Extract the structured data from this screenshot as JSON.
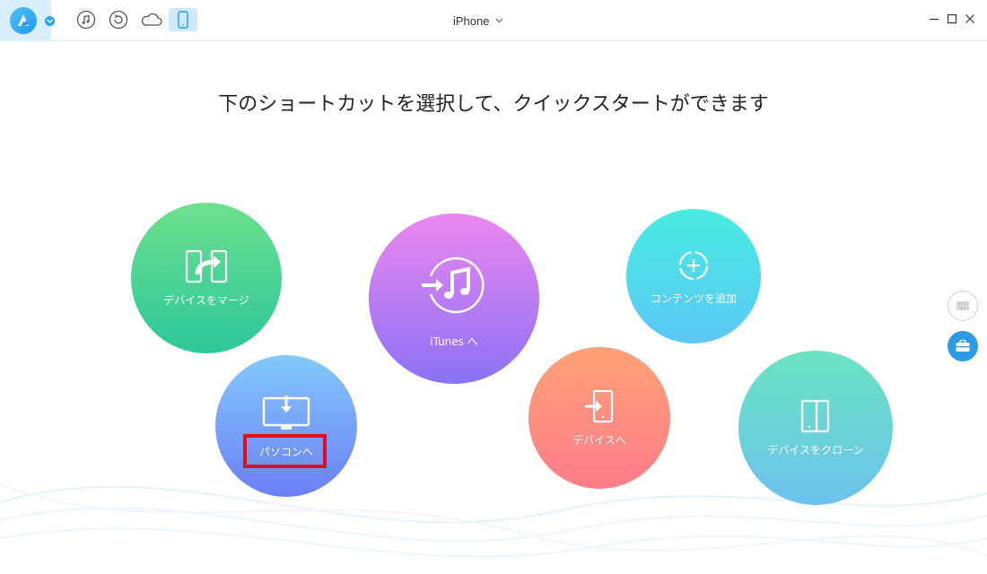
{
  "titlebar": {
    "device_name": "iPhone",
    "nav_icons": [
      "music-icon",
      "restore-icon",
      "cloud-icon",
      "phone-icon"
    ],
    "active_icon": "phone-icon"
  },
  "headline": "下のショートカットを選択して、クイックスタートができます",
  "shortcuts": {
    "merge": {
      "label": "デバイスをマージ",
      "icon": "merge-device-icon"
    },
    "itunes": {
      "label": "iTunes へ",
      "icon": "itunes-icon"
    },
    "content": {
      "label": "コンテンツを追加",
      "icon": "add-content-icon"
    },
    "pc": {
      "label": "パソコンへ",
      "icon": "computer-download-icon"
    },
    "device": {
      "label": "デバイスへ",
      "icon": "to-device-icon"
    },
    "clone": {
      "label": "デバイスをクローン",
      "icon": "clone-device-icon"
    }
  },
  "colors": {
    "accent": "#2c9be3",
    "highlight": "#e20d1b",
    "merge": [
      "#6ee08e",
      "#2cc79a"
    ],
    "itunes": [
      "#ec87f0",
      "#8b72f5"
    ],
    "content": [
      "#47ece0",
      "#5cc7f7"
    ],
    "pc": [
      "#83c9fb",
      "#6b7ff5"
    ],
    "device": [
      "#ffa176",
      "#fd7c8a"
    ],
    "clone": [
      "#6be3c1",
      "#6cc2ee"
    ]
  }
}
